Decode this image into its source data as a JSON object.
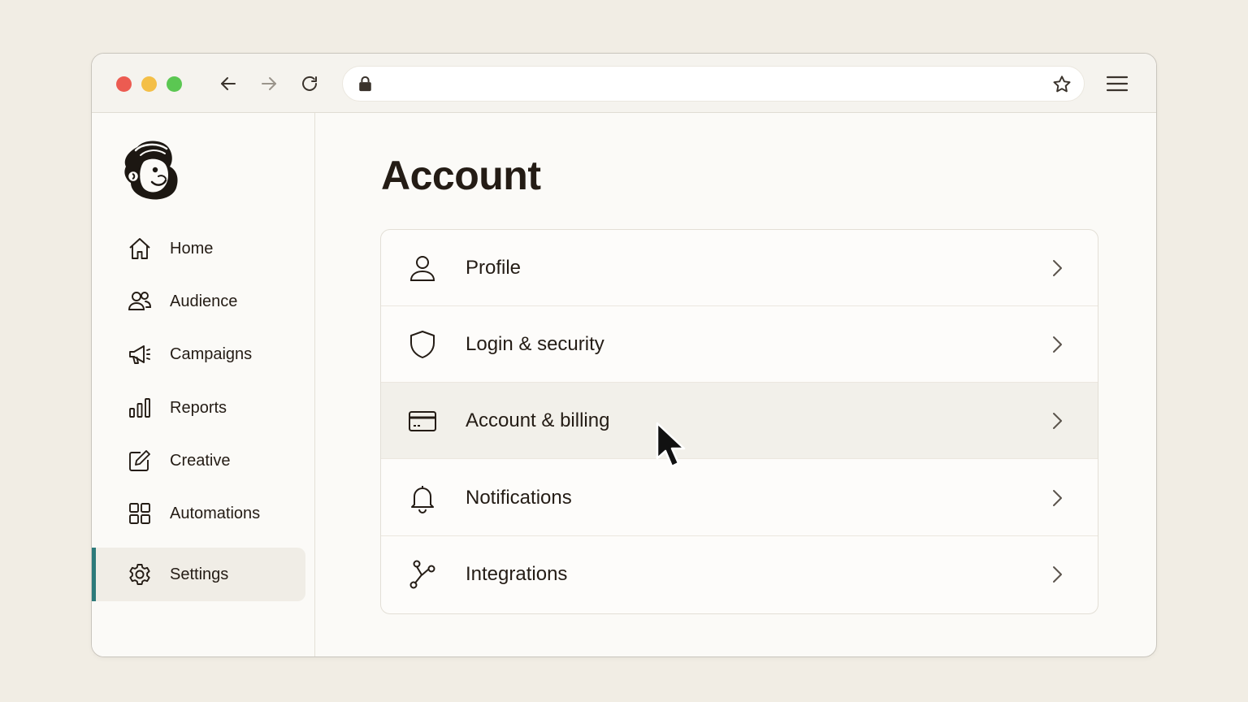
{
  "browser": {
    "url": "",
    "controls": [
      "back-icon",
      "forward-icon",
      "reload-icon"
    ],
    "bookmark_icon": "star-icon",
    "menu_icon": "hamburger-icon"
  },
  "sidebar": {
    "logo": "mailchimp-freddie-logo",
    "items": [
      {
        "label": "Home",
        "icon": "home-icon"
      },
      {
        "label": "Audience",
        "icon": "audience-icon"
      },
      {
        "label": "Campaigns",
        "icon": "megaphone-icon"
      },
      {
        "label": "Reports",
        "icon": "bar-chart-icon"
      },
      {
        "label": "Creative",
        "icon": "edit-icon"
      },
      {
        "label": "Automations",
        "icon": "grid-icon"
      },
      {
        "label": "Settings",
        "icon": "gear-icon",
        "active": true
      }
    ]
  },
  "main": {
    "title": "Account",
    "rows": [
      {
        "label": "Profile",
        "icon": "user-icon"
      },
      {
        "label": "Login & security",
        "icon": "shield-icon"
      },
      {
        "label": "Account & billing",
        "icon": "credit-card-icon",
        "hovered": true
      },
      {
        "label": "Notifications",
        "icon": "bell-icon"
      },
      {
        "label": "Integrations",
        "icon": "integrations-icon"
      }
    ]
  },
  "colors": {
    "background": "#f1ede4",
    "active_accent": "#2c7a7a",
    "text": "#241c15",
    "traffic_red": "#ec5b51",
    "traffic_yellow": "#f4bf47",
    "traffic_green": "#5bc752"
  }
}
